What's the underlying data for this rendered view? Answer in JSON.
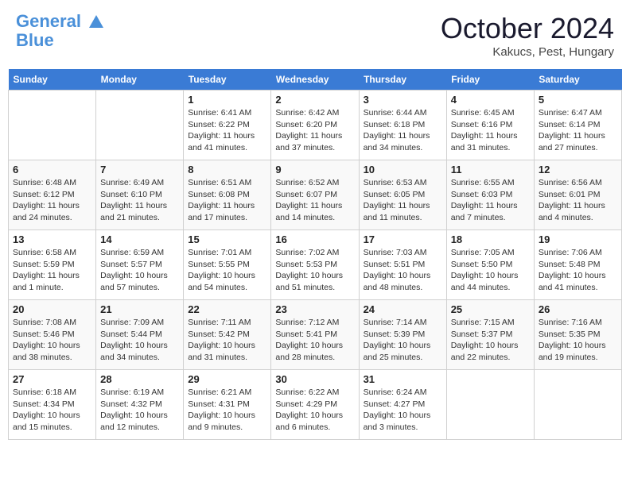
{
  "header": {
    "logo_line1": "General",
    "logo_line2": "Blue",
    "month": "October 2024",
    "location": "Kakucs, Pest, Hungary"
  },
  "weekdays": [
    "Sunday",
    "Monday",
    "Tuesday",
    "Wednesday",
    "Thursday",
    "Friday",
    "Saturday"
  ],
  "weeks": [
    [
      null,
      null,
      {
        "day": "1",
        "sunrise": "6:41 AM",
        "sunset": "6:22 PM",
        "daylight": "11 hours and 41 minutes."
      },
      {
        "day": "2",
        "sunrise": "6:42 AM",
        "sunset": "6:20 PM",
        "daylight": "11 hours and 37 minutes."
      },
      {
        "day": "3",
        "sunrise": "6:44 AM",
        "sunset": "6:18 PM",
        "daylight": "11 hours and 34 minutes."
      },
      {
        "day": "4",
        "sunrise": "6:45 AM",
        "sunset": "6:16 PM",
        "daylight": "11 hours and 31 minutes."
      },
      {
        "day": "5",
        "sunrise": "6:47 AM",
        "sunset": "6:14 PM",
        "daylight": "11 hours and 27 minutes."
      }
    ],
    [
      {
        "day": "6",
        "sunrise": "6:48 AM",
        "sunset": "6:12 PM",
        "daylight": "11 hours and 24 minutes."
      },
      {
        "day": "7",
        "sunrise": "6:49 AM",
        "sunset": "6:10 PM",
        "daylight": "11 hours and 21 minutes."
      },
      {
        "day": "8",
        "sunrise": "6:51 AM",
        "sunset": "6:08 PM",
        "daylight": "11 hours and 17 minutes."
      },
      {
        "day": "9",
        "sunrise": "6:52 AM",
        "sunset": "6:07 PM",
        "daylight": "11 hours and 14 minutes."
      },
      {
        "day": "10",
        "sunrise": "6:53 AM",
        "sunset": "6:05 PM",
        "daylight": "11 hours and 11 minutes."
      },
      {
        "day": "11",
        "sunrise": "6:55 AM",
        "sunset": "6:03 PM",
        "daylight": "11 hours and 7 minutes."
      },
      {
        "day": "12",
        "sunrise": "6:56 AM",
        "sunset": "6:01 PM",
        "daylight": "11 hours and 4 minutes."
      }
    ],
    [
      {
        "day": "13",
        "sunrise": "6:58 AM",
        "sunset": "5:59 PM",
        "daylight": "11 hours and 1 minute."
      },
      {
        "day": "14",
        "sunrise": "6:59 AM",
        "sunset": "5:57 PM",
        "daylight": "10 hours and 57 minutes."
      },
      {
        "day": "15",
        "sunrise": "7:01 AM",
        "sunset": "5:55 PM",
        "daylight": "10 hours and 54 minutes."
      },
      {
        "day": "16",
        "sunrise": "7:02 AM",
        "sunset": "5:53 PM",
        "daylight": "10 hours and 51 minutes."
      },
      {
        "day": "17",
        "sunrise": "7:03 AM",
        "sunset": "5:51 PM",
        "daylight": "10 hours and 48 minutes."
      },
      {
        "day": "18",
        "sunrise": "7:05 AM",
        "sunset": "5:50 PM",
        "daylight": "10 hours and 44 minutes."
      },
      {
        "day": "19",
        "sunrise": "7:06 AM",
        "sunset": "5:48 PM",
        "daylight": "10 hours and 41 minutes."
      }
    ],
    [
      {
        "day": "20",
        "sunrise": "7:08 AM",
        "sunset": "5:46 PM",
        "daylight": "10 hours and 38 minutes."
      },
      {
        "day": "21",
        "sunrise": "7:09 AM",
        "sunset": "5:44 PM",
        "daylight": "10 hours and 34 minutes."
      },
      {
        "day": "22",
        "sunrise": "7:11 AM",
        "sunset": "5:42 PM",
        "daylight": "10 hours and 31 minutes."
      },
      {
        "day": "23",
        "sunrise": "7:12 AM",
        "sunset": "5:41 PM",
        "daylight": "10 hours and 28 minutes."
      },
      {
        "day": "24",
        "sunrise": "7:14 AM",
        "sunset": "5:39 PM",
        "daylight": "10 hours and 25 minutes."
      },
      {
        "day": "25",
        "sunrise": "7:15 AM",
        "sunset": "5:37 PM",
        "daylight": "10 hours and 22 minutes."
      },
      {
        "day": "26",
        "sunrise": "7:16 AM",
        "sunset": "5:35 PM",
        "daylight": "10 hours and 19 minutes."
      }
    ],
    [
      {
        "day": "27",
        "sunrise": "6:18 AM",
        "sunset": "4:34 PM",
        "daylight": "10 hours and 15 minutes."
      },
      {
        "day": "28",
        "sunrise": "6:19 AM",
        "sunset": "4:32 PM",
        "daylight": "10 hours and 12 minutes."
      },
      {
        "day": "29",
        "sunrise": "6:21 AM",
        "sunset": "4:31 PM",
        "daylight": "10 hours and 9 minutes."
      },
      {
        "day": "30",
        "sunrise": "6:22 AM",
        "sunset": "4:29 PM",
        "daylight": "10 hours and 6 minutes."
      },
      {
        "day": "31",
        "sunrise": "6:24 AM",
        "sunset": "4:27 PM",
        "daylight": "10 hours and 3 minutes."
      },
      null,
      null
    ]
  ]
}
